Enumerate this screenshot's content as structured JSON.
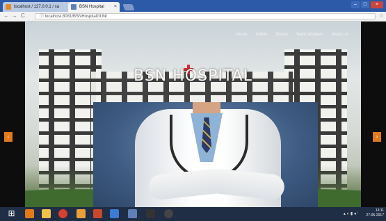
{
  "browser": {
    "tabs": [
      {
        "label": "localhost / 127.0.0.1 / xa",
        "active": false,
        "favicon_color": "#e38a2b"
      },
      {
        "label": "BSN Hospital",
        "active": true,
        "favicon_color": "#5f7fb8"
      }
    ],
    "tab_close_glyph": "×",
    "address": "localhost:8081/BSNHospitalGUN/",
    "window_controls": {
      "minimize": "–",
      "maximize": "□",
      "close": "×"
    },
    "icons": {
      "back": "←",
      "forward": "→",
      "reload": "C",
      "info": "ⓘ",
      "star": "☆"
    }
  },
  "site": {
    "title": "BSN HOSPITAL",
    "nav": [
      "Home",
      "Admin",
      "Doctor",
      "Ward Workers",
      "About Us"
    ],
    "slider_arrows": {
      "left": "‹",
      "right": "›"
    }
  },
  "taskbar": {
    "start_glyph": "⊞",
    "apps": [
      "#e07a1b",
      "#f0c24a",
      "#d8402f",
      "#e8a13a",
      "#c8482d",
      "#3c7ad6",
      "#5f7fb8",
      "#333333",
      "#444444"
    ],
    "tray_text": "▴ ◐ ▮ ◂ ⁾",
    "clock": {
      "time": "13:11",
      "date": "27-05-2017"
    }
  }
}
